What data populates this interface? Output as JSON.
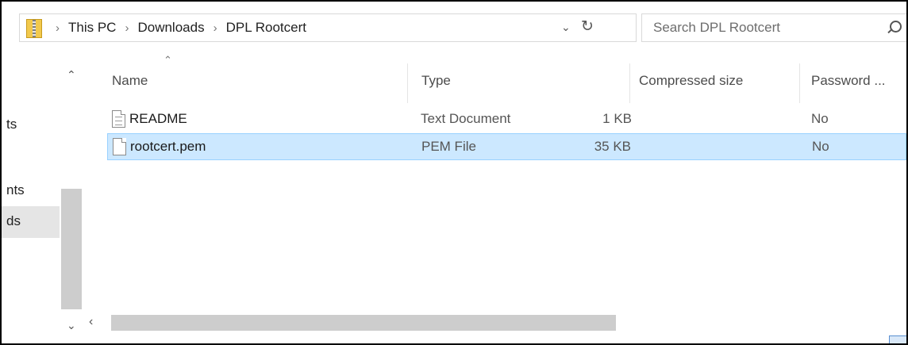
{
  "address": {
    "breadcrumbs": [
      "This PC",
      "Downloads",
      "DPL Rootcert"
    ],
    "separator": "›"
  },
  "search": {
    "placeholder": "Search DPL Rootcert"
  },
  "nav": {
    "items": [
      "ts",
      "nts",
      "ds"
    ],
    "selected": "ds"
  },
  "columns": {
    "name": "Name",
    "type": "Type",
    "compressed_size": "Compressed size",
    "password": "Password ..."
  },
  "files": [
    {
      "name": "README",
      "type": "Text Document",
      "size": "1 KB",
      "password": "No",
      "icon": "text-document-icon",
      "selected": false
    },
    {
      "name": "rootcert.pem",
      "type": "PEM File",
      "size": "35 KB",
      "password": "No",
      "icon": "file-icon",
      "selected": true
    }
  ],
  "colors": {
    "selection": "#cce8ff",
    "selection_border": "#99d1ff"
  }
}
